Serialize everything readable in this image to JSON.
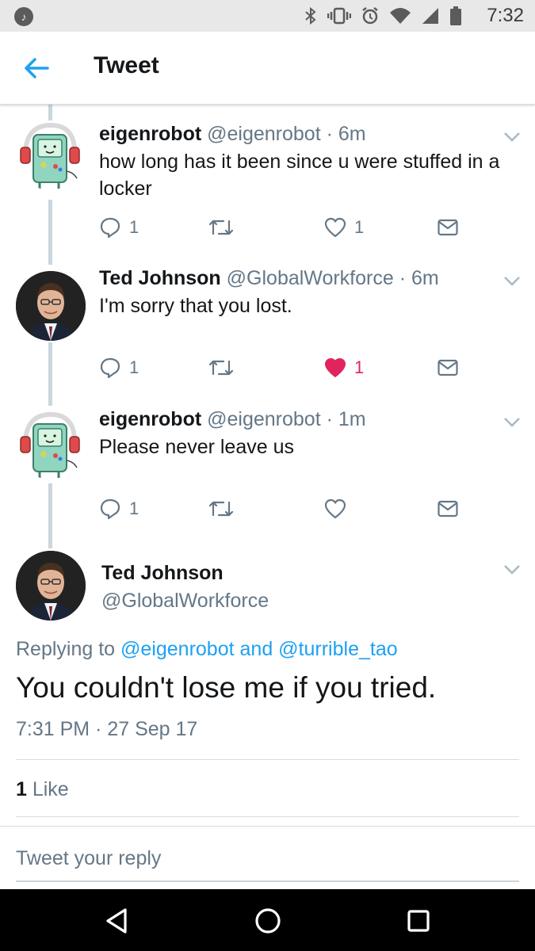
{
  "status_bar": {
    "time": "7:32",
    "icons": [
      "music-icon",
      "bluetooth-icon",
      "vibrate-icon",
      "alarm-icon",
      "wifi-icon",
      "signal-icon",
      "battery-icon"
    ]
  },
  "header": {
    "title": "Tweet"
  },
  "thread": [
    {
      "name": "eigenrobot",
      "handle": "@eigenrobot",
      "time": " · 6m",
      "text": "how long has it been since u were stuffed in a locker",
      "reply_count": "1",
      "retweet_count": "",
      "like_count": "1",
      "liked": false
    },
    {
      "name": "Ted Johnson",
      "handle": "@GlobalWorkforce",
      "time": " · 6m",
      "text": "I'm sorry that you lost.",
      "reply_count": "1",
      "retweet_count": "",
      "like_count": "1",
      "liked": true
    },
    {
      "name": "eigenrobot",
      "handle": "@eigenrobot",
      "time": " · 1m",
      "text": "Please never leave us",
      "reply_count": "1",
      "retweet_count": "",
      "like_count": "",
      "liked": false
    }
  ],
  "focused": {
    "name": "Ted Johnson",
    "handle": "@GlobalWorkforce",
    "replying_prefix": "Replying to ",
    "replying_user1": "@eigenrobot",
    "replying_and": " and ",
    "replying_user2": "@turrible_tao",
    "text": "You couldn't lose me if you tried.",
    "timestamp": "7:31 PM · 27 Sep 17",
    "likes_count": "1",
    "likes_label": " Like"
  },
  "reply": {
    "placeholder": "Tweet your reply"
  },
  "colors": {
    "accent": "#1da1f2",
    "like": "#e0245e",
    "secondary_text": "#657786"
  }
}
